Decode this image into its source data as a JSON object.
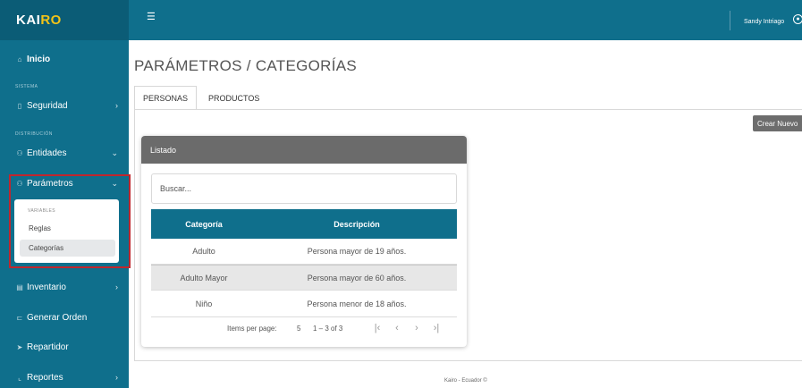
{
  "brand": {
    "part1": "KAI",
    "part2": "RO"
  },
  "topbar": {
    "menu_icon": "hamburger-icon",
    "user_name": "Sandy Intriago",
    "user_icon": "user-circle-icon"
  },
  "sidebar": {
    "inicio": "Inicio",
    "section_sistema": "SISTEMA",
    "seguridad": "Seguridad",
    "section_distribucion": "DISTRIBUCIÓN",
    "entidades": "Entidades",
    "parametros": "Parámetros",
    "submenu": {
      "section": "VARIABLES",
      "items": [
        "Reglas",
        "Categorías"
      ],
      "active": "Categorías"
    },
    "inventario": "Inventario",
    "generar_orden": "Generar Orden",
    "repartidor": "Repartidor",
    "reportes": "Reportes"
  },
  "page": {
    "title": "PARÁMETROS / CATEGORÍAS",
    "tabs": [
      "PERSONAS",
      "PRODUCTOS"
    ],
    "active_tab": "PERSONAS",
    "new_button": "Crear Nuevo"
  },
  "card": {
    "header": "Listado",
    "search_placeholder": "Buscar...",
    "columns": [
      "Categoría",
      "Descripción"
    ],
    "rows": [
      {
        "categoria": "Adulto",
        "descripcion": "Persona mayor de 19 años."
      },
      {
        "categoria": "Adulto Mayor",
        "descripcion": "Persona mayor de 60 años."
      },
      {
        "categoria": "Niño",
        "descripcion": "Persona menor de 18 años."
      }
    ],
    "paginator": {
      "label": "Items per page:",
      "page_size": "5",
      "range": "1 – 3 of 3"
    }
  },
  "footer": "Kairo - Ecuador ©",
  "colors": {
    "primary": "#0f6f8c",
    "brand_accent": "#f2c318",
    "highlight": "#c0262d",
    "card_header": "#6b6b6b"
  }
}
